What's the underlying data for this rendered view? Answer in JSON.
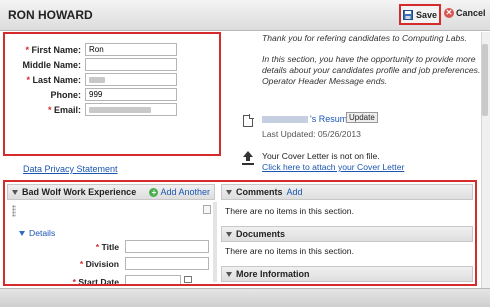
{
  "header": {
    "title": "RON HOWARD",
    "save_label": "Save",
    "cancel_label": "Cancel"
  },
  "form": {
    "first_name": {
      "label": "First Name:",
      "required": true,
      "value": "Ron"
    },
    "middle_name": {
      "label": "Middle Name:",
      "required": false,
      "value": ""
    },
    "last_name": {
      "label": "Last Name:",
      "required": true,
      "value": ""
    },
    "phone": {
      "label": "Phone:",
      "required": false,
      "value": "999"
    },
    "email": {
      "label": "Email:",
      "required": true,
      "value": ""
    }
  },
  "data_privacy_label": "Data Privacy Statement",
  "messages": {
    "thanks": "Thank you for refering candidates to Computing Labs.",
    "intro": "In this section, you have the opportunity to provide more details about your candidates profile and job preferences.",
    "operator": "Operator Header Message ends."
  },
  "resume": {
    "link_suffix": "'s Resume",
    "update_label": "Update",
    "last_updated": "Last Updated: 05/26/2013"
  },
  "cover_letter": {
    "status": "Your Cover Letter is not on file.",
    "attach_label": "Click here to attach your Cover Letter"
  },
  "work_experience": {
    "title": "Bad Wolf Work Experience",
    "add_label": "Add Another",
    "details_label": "Details",
    "fields": [
      "Title",
      "Division",
      "Start Date"
    ]
  },
  "right_sections": {
    "comments": {
      "title": "Comments",
      "add_label": "Add",
      "empty": "There are no items in this section."
    },
    "documents": {
      "title": "Documents",
      "empty": "There are no items in this section."
    },
    "more_info": {
      "title": "More Information"
    }
  }
}
